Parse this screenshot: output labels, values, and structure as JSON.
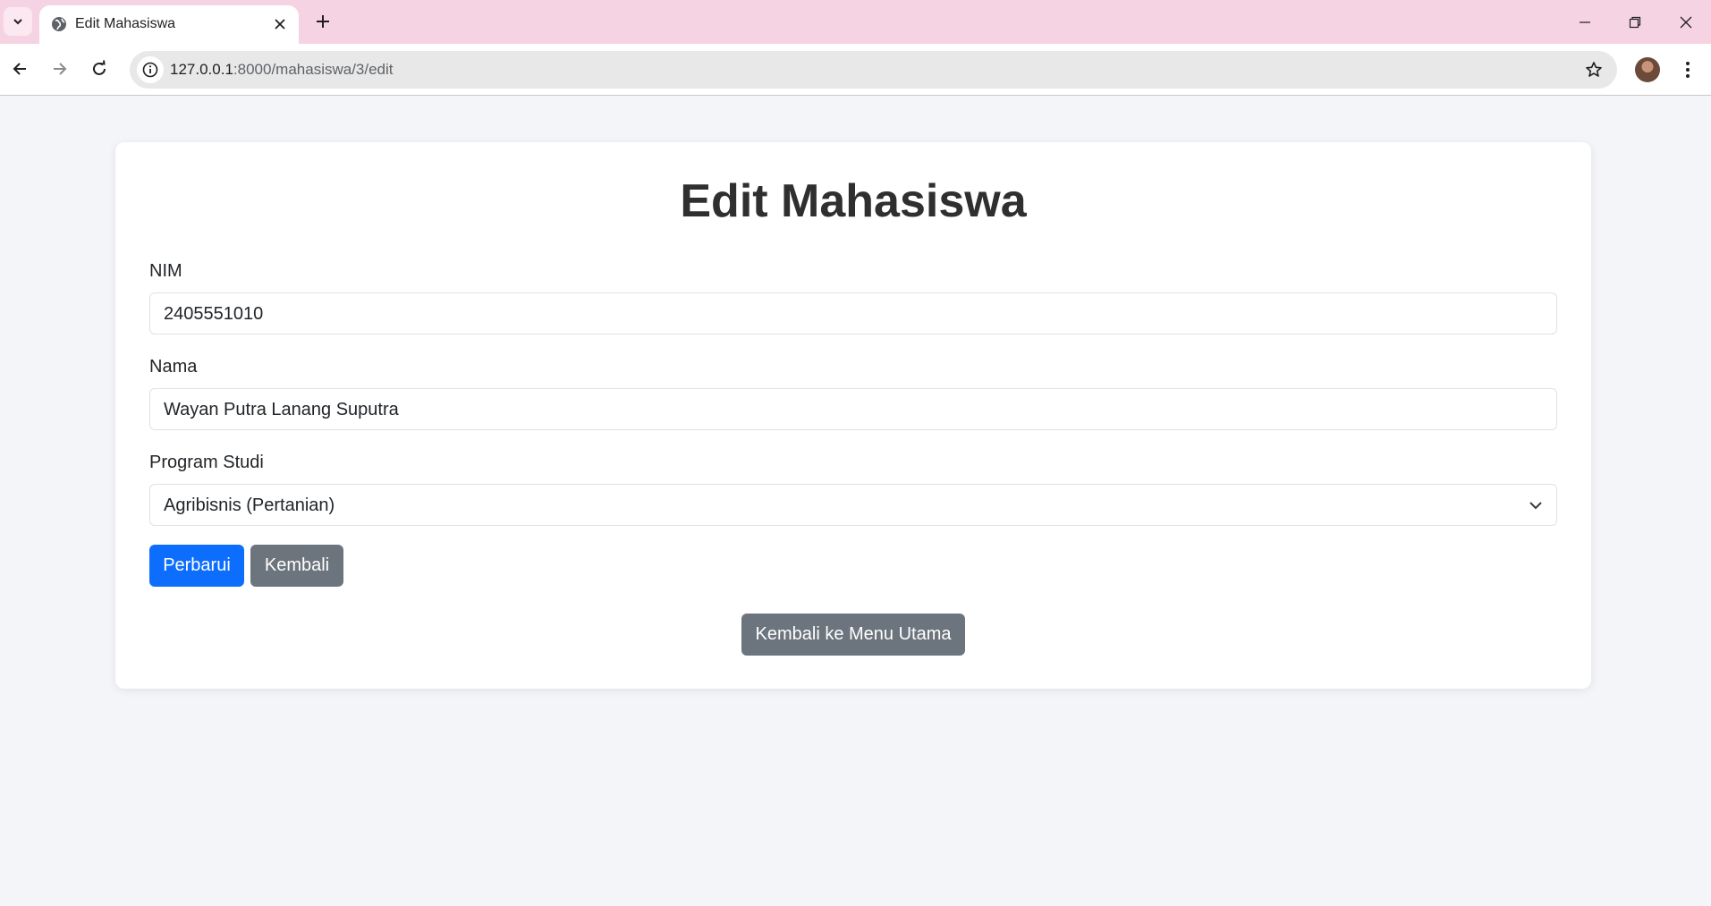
{
  "browser": {
    "tab_title": "Edit Mahasiswa",
    "url_host": "127.0.0.1",
    "url_path": ":8000/mahasiswa/3/edit"
  },
  "page": {
    "title": "Edit Mahasiswa",
    "nim_label": "NIM",
    "nim_value": "2405551010",
    "nama_label": "Nama",
    "nama_value": "Wayan Putra Lanang Suputra",
    "prodi_label": "Program Studi",
    "prodi_value": "Agribisnis (Pertanian)",
    "update_button": "Perbarui",
    "back_button": "Kembali",
    "main_menu_button": "Kembali ke Menu Utama"
  },
  "colors": {
    "primary": "#0d6efd",
    "secondary": "#6c757d",
    "tabbar": "#f6d3e2"
  }
}
